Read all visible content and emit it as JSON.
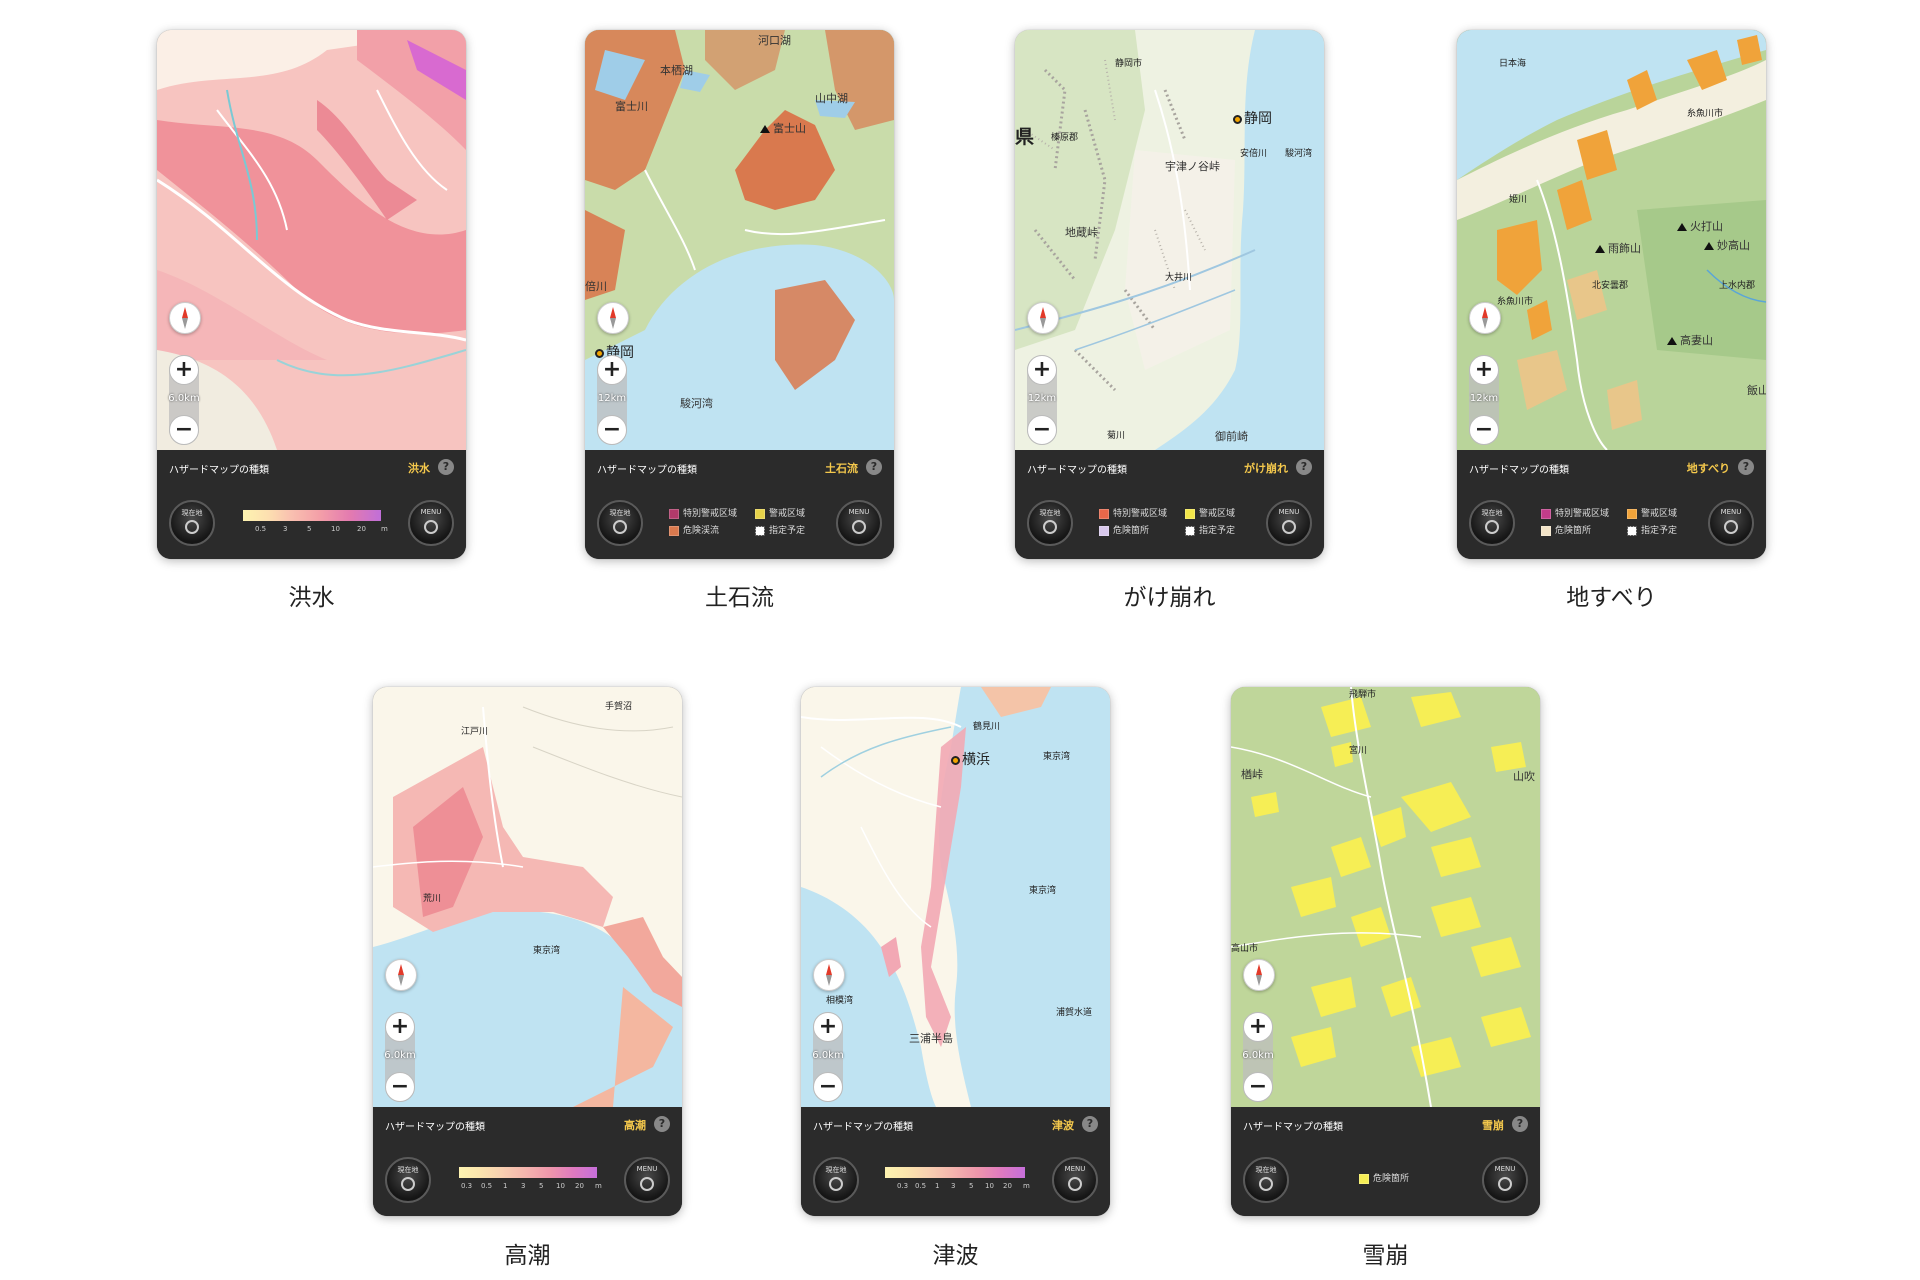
{
  "panel_title": "ハザードマップの種類",
  "help_glyph": "?",
  "locate_button": "現在地",
  "menu_button": "MENU",
  "zoom_in": "+",
  "zoom_out": "−",
  "cards": [
    {
      "caption": "洪水",
      "type": "洪水",
      "scale": "6.0km",
      "gradient_ticks": [
        "0.5",
        "3",
        "5",
        "10",
        "20",
        "m"
      ]
    },
    {
      "caption": "土石流",
      "type": "土石流",
      "scale": "12km",
      "labels": {
        "kawaguchiko": "河口湖",
        "motosuko": "本栖湖",
        "fujikawa": "富士川",
        "yamanakako": "山中湖",
        "fujisan": "富士山",
        "abekawa": "倍川",
        "shizuoka": "静岡",
        "surugawan": "駿河湾"
      },
      "legend": {
        "a": "特別警戒区域",
        "b": "警戒区域",
        "c": "危険渓流",
        "d": "指定予定"
      }
    },
    {
      "caption": "がけ崩れ",
      "type": "がけ崩れ",
      "scale": "12km",
      "labels": {
        "ken": "県",
        "shizuokashi": "静岡市",
        "shizuoka": "静岡",
        "haibara": "榛原郡",
        "abe": "安倍川",
        "suruga": "駿河湾",
        "utsunoya": "宇津ノ谷峠",
        "jizo": "地蔵峠",
        "oi": "大井川",
        "kiku": "菊川",
        "omaezaki": "御前崎"
      },
      "legend": {
        "a": "特別警戒区域",
        "b": "警戒区域",
        "c": "危険箇所",
        "d": "指定予定"
      }
    },
    {
      "caption": "地すべり",
      "type": "地すべり",
      "scale": "12km",
      "labels": {
        "nihonkai": "日本海",
        "itoigawashi": "糸魚川市",
        "himekawa": "姫川",
        "hiuchi": "火打山",
        "amakazari": "雨飾山",
        "myoko": "妙高山",
        "kitaazumi": "北安曇郡",
        "itoigawa": "糸魚川市",
        "kamiminochi": "上水内郡",
        "takatsuma": "高妻山",
        "iiyama": "飯山"
      },
      "legend": {
        "a": "特別警戒区域",
        "b": "警戒区域",
        "c": "危険箇所",
        "d": "指定予定"
      }
    },
    {
      "caption": "高潮",
      "type": "高潮",
      "scale": "6.0km",
      "labels": {
        "tega": "手賀沼",
        "edogawa": "江戸川",
        "arakawa": "荒川",
        "tokyowan": "東京湾"
      },
      "gradient_ticks": [
        "0.3",
        "0.5",
        "1",
        "3",
        "5",
        "10",
        "20",
        "m"
      ]
    },
    {
      "caption": "津波",
      "type": "津波",
      "scale": "6.0km",
      "labels": {
        "tsurumi": "鶴見川",
        "yokohama": "横浜",
        "tokyowan1": "東京湾",
        "tokyowan2": "東京湾",
        "sagamiwan": "相模湾",
        "uraga": "浦賀水道",
        "miura": "三浦半島"
      },
      "gradient_ticks": [
        "0.3",
        "0.5",
        "1",
        "3",
        "5",
        "10",
        "20",
        "m"
      ]
    },
    {
      "caption": "雪崩",
      "type": "雪崩",
      "scale": "6.0km",
      "labels": {
        "hida": "飛騨市",
        "miyagawa": "宮川",
        "toge": "楢峠",
        "yamabuki": "山吹",
        "takayama": "高山市"
      },
      "legend": {
        "a": "危険箇所"
      }
    }
  ],
  "colors": {
    "flood": "#f08a96",
    "debris": "#d9794e",
    "cliff": "#b8b0a8",
    "landslide": "#f0a33a",
    "surge": "#f3a0a0",
    "tsunami": "#f2a8b4",
    "avalanche": "#f6ee55",
    "water": "#bfe3f2",
    "forest": "#c5d9a3",
    "accent": "#f4c84c"
  }
}
